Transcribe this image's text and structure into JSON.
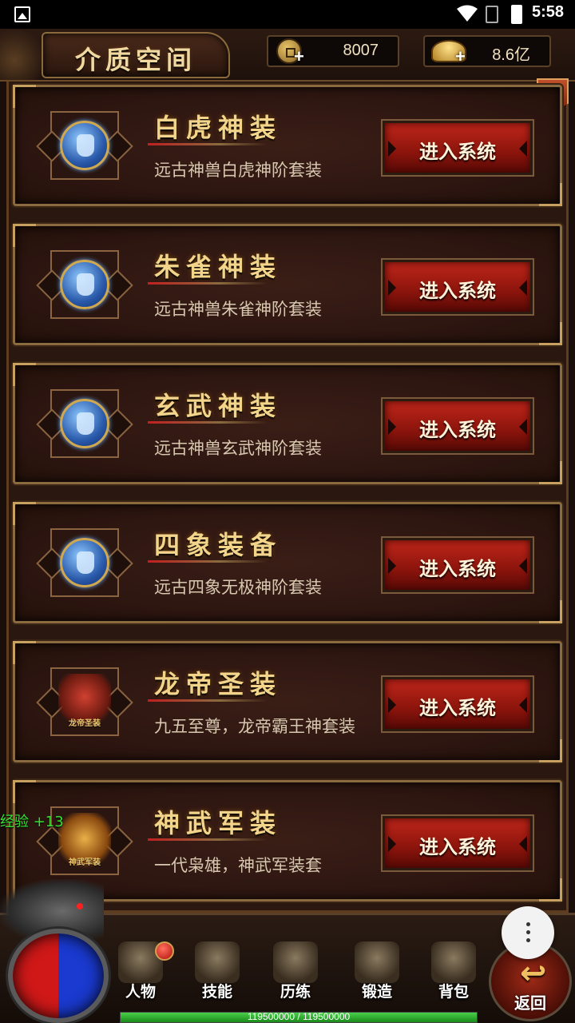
{
  "status_bar": {
    "time": "5:58"
  },
  "header": {
    "title": "介质空间",
    "copper": "8007",
    "gold": "8.6亿",
    "plus": "+"
  },
  "close_label": "×",
  "cards": [
    {
      "title": "白虎神装",
      "desc": "远古神兽白虎神阶套装",
      "button": "进入系统",
      "icon": "white-tiger-armor-icon"
    },
    {
      "title": "朱雀神装",
      "desc": "远古神兽朱雀神阶套装",
      "button": "进入系统",
      "icon": "vermilion-bird-armor-icon"
    },
    {
      "title": "玄武神装",
      "desc": "远古神兽玄武神阶套装",
      "button": "进入系统",
      "icon": "black-tortoise-armor-icon"
    },
    {
      "title": "四象装备",
      "desc": "远古四象无极神阶套装",
      "button": "进入系统",
      "icon": "four-symbols-armor-icon"
    },
    {
      "title": "龙帝圣装",
      "desc": "九五至尊，龙帝霸王神套装",
      "button": "进入系统",
      "icon": "dragon-emperor-emblem-icon",
      "emblem_text": "龙帝圣装"
    },
    {
      "title": "神武军装",
      "desc": "一代枭雄，神武军装套",
      "button": "进入系统",
      "icon": "divine-military-emblem-icon",
      "emblem_text": "神武军装"
    }
  ],
  "exp_popup": "经验 +13",
  "nav": {
    "character": "人物",
    "skills": "技能",
    "training": "历练",
    "forge": "锻造",
    "bag": "背包",
    "back": "返回"
  },
  "xp": {
    "text": "119500000 / 119500000",
    "fraction": 1.0
  },
  "colors": {
    "accent_gold": "#f2d48a",
    "button_red": "#c0261a",
    "exp_green": "#34e034"
  }
}
